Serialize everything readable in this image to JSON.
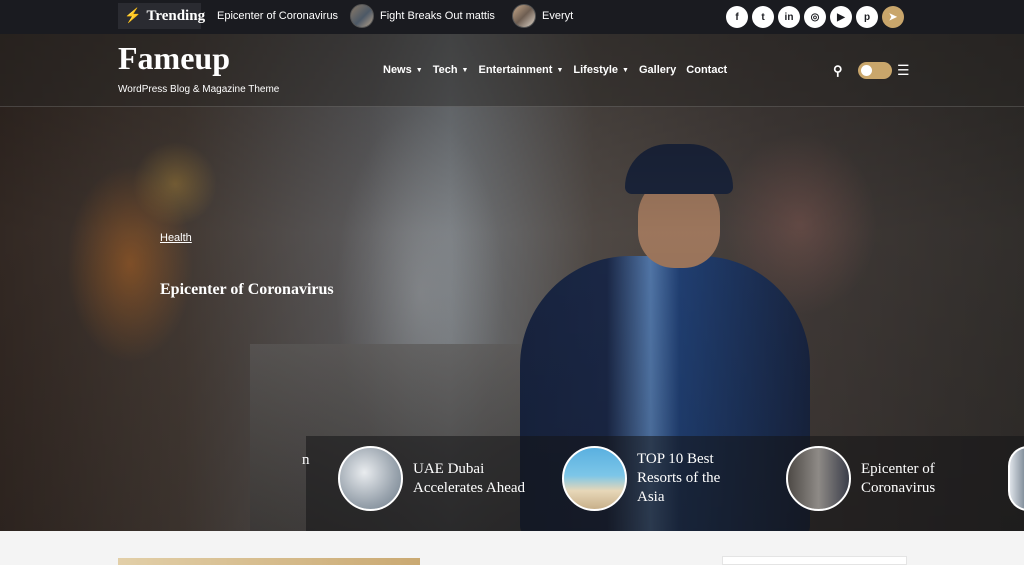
{
  "topbar": {
    "trending_label": "Trending",
    "ticker": [
      {
        "text": "Epicenter of Coronavirus"
      },
      {
        "text": "Fight Breaks Out mattis"
      },
      {
        "text": "Everyt"
      }
    ],
    "socials": [
      {
        "icon": "facebook-icon",
        "glyph": "f"
      },
      {
        "icon": "twitter-icon",
        "glyph": "t"
      },
      {
        "icon": "linkedin-icon",
        "glyph": "in"
      },
      {
        "icon": "instagram-icon",
        "glyph": "◎"
      },
      {
        "icon": "youtube-icon",
        "glyph": "▶"
      },
      {
        "icon": "pinterest-icon",
        "glyph": "p"
      },
      {
        "icon": "telegram-icon",
        "glyph": "➤"
      }
    ]
  },
  "header": {
    "logo": "Fameup",
    "tagline": "WordPress Blog & Magazine Theme",
    "nav": [
      {
        "label": "News",
        "dropdown": true
      },
      {
        "label": "Tech",
        "dropdown": true
      },
      {
        "label": "Entertainment",
        "dropdown": true
      },
      {
        "label": "Lifestyle",
        "dropdown": true
      },
      {
        "label": "Gallery",
        "dropdown": false
      },
      {
        "label": "Contact",
        "dropdown": false
      }
    ],
    "accent_color": "#c9a66b"
  },
  "hero": {
    "category": "Health",
    "title": "Epicenter of Coronavirus"
  },
  "slider": {
    "clipped_text": "n",
    "items": [
      {
        "title": "UAE Dubai Accelerates Ahead"
      },
      {
        "title": "TOP 10 Best Resorts of the Asia"
      },
      {
        "title": "Epicenter of Coronavirus"
      }
    ]
  }
}
